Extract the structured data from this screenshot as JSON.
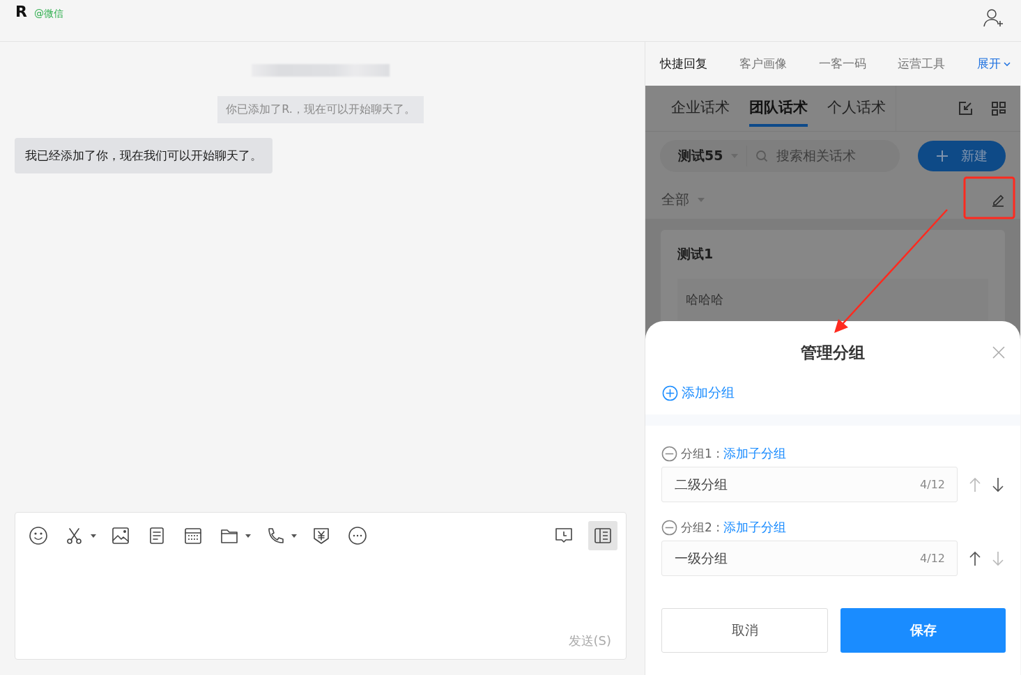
{
  "header": {
    "name": "R",
    "source": "@微信"
  },
  "chat": {
    "system_notice": "你已添加了R.，现在可以开始聊天了。",
    "messages": [
      {
        "text": "我已经添加了你，现在我们可以开始聊天了。"
      }
    ]
  },
  "composer": {
    "tools": [
      {
        "kind": "emoji",
        "dropdown": false,
        "selected": false
      },
      {
        "kind": "scissors",
        "dropdown": true,
        "selected": false
      },
      {
        "kind": "image",
        "dropdown": false,
        "selected": false
      },
      {
        "kind": "document",
        "dropdown": false,
        "selected": false
      },
      {
        "kind": "calendar",
        "dropdown": false,
        "selected": false
      },
      {
        "kind": "folder",
        "dropdown": true,
        "selected": false
      },
      {
        "kind": "phone",
        "dropdown": true,
        "selected": false
      },
      {
        "kind": "yen-shield",
        "dropdown": false,
        "selected": false
      },
      {
        "kind": "more",
        "dropdown": false,
        "selected": false
      }
    ],
    "right_tools": [
      {
        "kind": "history",
        "selected": false
      },
      {
        "kind": "sidebar",
        "selected": true
      }
    ],
    "send_label": "发送(S)"
  },
  "side_tabs": [
    {
      "label": "快捷回复",
      "selected": true
    },
    {
      "label": "客户画像",
      "selected": false
    },
    {
      "label": "一客一码",
      "selected": false
    },
    {
      "label": "运营工具",
      "selected": false
    }
  ],
  "expand_label": "展开",
  "script_tabs": [
    {
      "label": "企业话术",
      "selected": false
    },
    {
      "label": "团队话术",
      "selected": true
    },
    {
      "label": "个人话术",
      "selected": false
    }
  ],
  "category": "测试55",
  "search_placeholder": "搜索相关话术",
  "new_label": "新建",
  "filter": "全部",
  "cards": [
    {
      "title": "测试1",
      "body": "哈哈哈"
    }
  ],
  "dialog": {
    "title": "管理分组",
    "add_group": "添加分组",
    "groups": [
      {
        "label": "分组1 :",
        "add_sub": "添加子分组",
        "value": "二级分组",
        "count": "4/12",
        "can_move_up": false,
        "can_move_down": true
      },
      {
        "label": "分组2 :",
        "add_sub": "添加子分组",
        "value": "一级分组",
        "count": "4/12",
        "can_move_up": true,
        "can_move_down": false
      }
    ],
    "cancel": "取消",
    "save": "保存"
  }
}
